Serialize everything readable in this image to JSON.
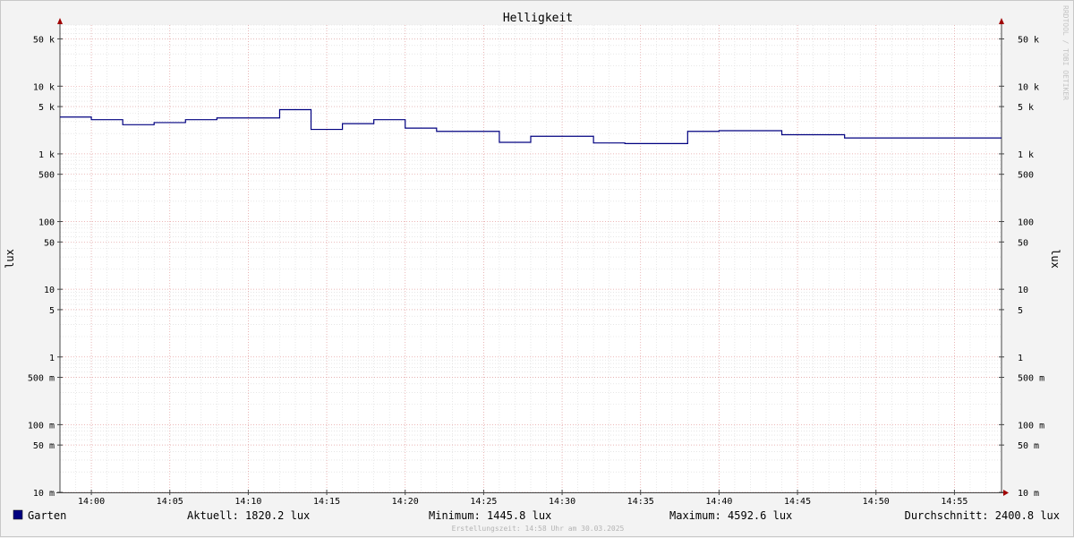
{
  "chart_data": {
    "type": "line",
    "title": "Helligkeit",
    "ylabel": "lux",
    "y_scale": "log",
    "ylim": [
      0.01,
      80000
    ],
    "xlim": [
      "13:58",
      "14:58"
    ],
    "x_ticks": [
      "14:00",
      "14:05",
      "14:10",
      "14:15",
      "14:20",
      "14:25",
      "14:30",
      "14:35",
      "14:40",
      "14:45",
      "14:50",
      "14:55"
    ],
    "y_ticks": [
      {
        "value": 50000,
        "label": "50 k"
      },
      {
        "value": 10000,
        "label": "10 k"
      },
      {
        "value": 5000,
        "label": "5 k"
      },
      {
        "value": 1000,
        "label": "1 k"
      },
      {
        "value": 500,
        "label": "500"
      },
      {
        "value": 100,
        "label": "100"
      },
      {
        "value": 50,
        "label": "50"
      },
      {
        "value": 10,
        "label": "10"
      },
      {
        "value": 5,
        "label": "5"
      },
      {
        "value": 1,
        "label": "1"
      },
      {
        "value": 0.5,
        "label": "500 m"
      },
      {
        "value": 0.1,
        "label": "100 m"
      },
      {
        "value": 0.05,
        "label": "50 m"
      },
      {
        "value": 0.01,
        "label": "10 m"
      }
    ],
    "grid": true,
    "series": [
      {
        "name": "Garten",
        "color": "#000080",
        "step": true,
        "x": [
          "13:58",
          "14:00",
          "14:02",
          "14:04",
          "14:06",
          "14:08",
          "14:10",
          "14:12",
          "14:14",
          "14:16",
          "14:18",
          "14:20",
          "14:22",
          "14:24",
          "14:26",
          "14:28",
          "14:30",
          "14:32",
          "14:34",
          "14:36",
          "14:38",
          "14:40",
          "14:42",
          "14:44",
          "14:46",
          "14:48",
          "14:50",
          "14:52",
          "14:54",
          "14:56",
          "14:58"
        ],
        "y": [
          3500,
          3200,
          2700,
          2900,
          3200,
          3400,
          3400,
          4500,
          2300,
          2800,
          3200,
          2400,
          2150,
          2150,
          1480,
          1820,
          1820,
          1450,
          1420,
          1420,
          2150,
          2200,
          2200,
          1920,
          1920,
          1720,
          1720,
          1720,
          1720,
          1720,
          1720
        ]
      }
    ],
    "legend": {
      "position": "bottom-left",
      "color": "#000080",
      "label": "Garten"
    },
    "stats": {
      "current": "Aktuell: 1820.2 lux",
      "minimum": "Minimum: 1445.8 lux",
      "maximum": "Maximum: 4592.6 lux",
      "average": "Durchschnitt: 2400.8 lux"
    },
    "watermark": "RRDTOOL / TOBI OETIKER",
    "footer": "Erstellungszeit: 14:58 Uhr am 30.03.2025"
  }
}
